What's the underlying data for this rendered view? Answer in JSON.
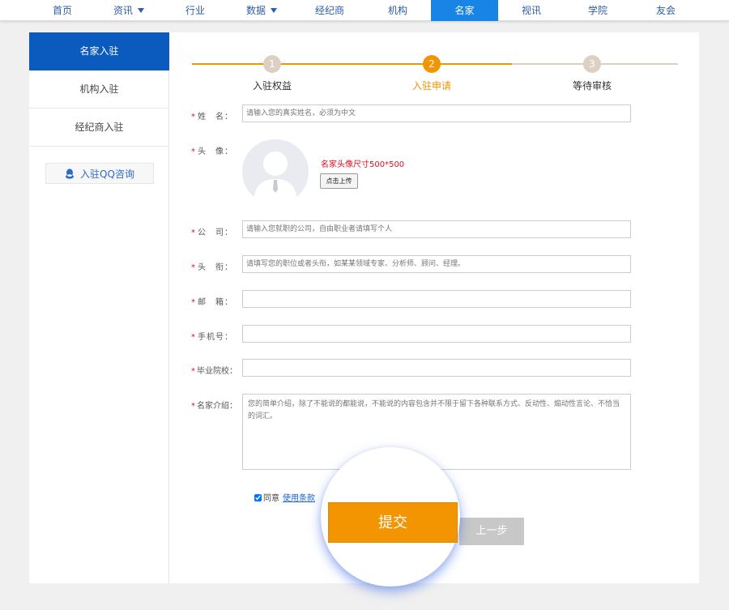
{
  "nav": {
    "items": [
      {
        "label": "首页"
      },
      {
        "label": "资讯"
      },
      {
        "label": "行业"
      },
      {
        "label": "数据"
      },
      {
        "label": "经纪商"
      },
      {
        "label": "机构"
      },
      {
        "label": "名家"
      },
      {
        "label": "视讯"
      },
      {
        "label": "学院"
      },
      {
        "label": "友会"
      }
    ],
    "active_color": "#1784e6"
  },
  "sidebar": {
    "items": [
      {
        "label": "名家入驻"
      },
      {
        "label": "机构入驻"
      },
      {
        "label": "经纪商入驻"
      }
    ],
    "qq_label": "入驻QQ咨询"
  },
  "steps": [
    {
      "num": "1",
      "label": "入驻权益"
    },
    {
      "num": "2",
      "label": "入驻申请"
    },
    {
      "num": "3",
      "label": "等待审核"
    }
  ],
  "form": {
    "name_label": "姓　名：",
    "name_placeholder": "请输入您的真实姓名，必须为中文",
    "avatar_label": "头　像：",
    "avatar_note": "名家头像尺寸500*500",
    "upload_label": "点击上传",
    "company_label": "公　司：",
    "company_placeholder": "请输入您就职的公司，自由职业者请填写个人",
    "title_label": "头　衔：",
    "title_placeholder": "请填写您的职位或者头衔，如某某领域专家、分析师、顾问、经理。",
    "email_label": "邮　箱：",
    "phone_label": "手机号：",
    "school_label": "毕业院校：",
    "intro_label": "名家介绍：",
    "intro_placeholder": "您的简单介绍，除了不能说的都能说，不能说的内容包含并不限于留下各种联系方式、反动性、煽动性言论、不恰当的词汇。",
    "required_mark": "*",
    "agree_label": "同意",
    "terms_label": "使用条款",
    "submit_label": "提交",
    "prev_label": "上一步"
  },
  "colors": {
    "accent_orange": "#f29500",
    "step_inactive": "#ddd0c2",
    "sidebar_active": "#0b5bbf",
    "required_red": "#dd1122"
  },
  "icons": [
    "qq-icon",
    "chevron-down-icon",
    "avatar-placeholder-icon"
  ]
}
